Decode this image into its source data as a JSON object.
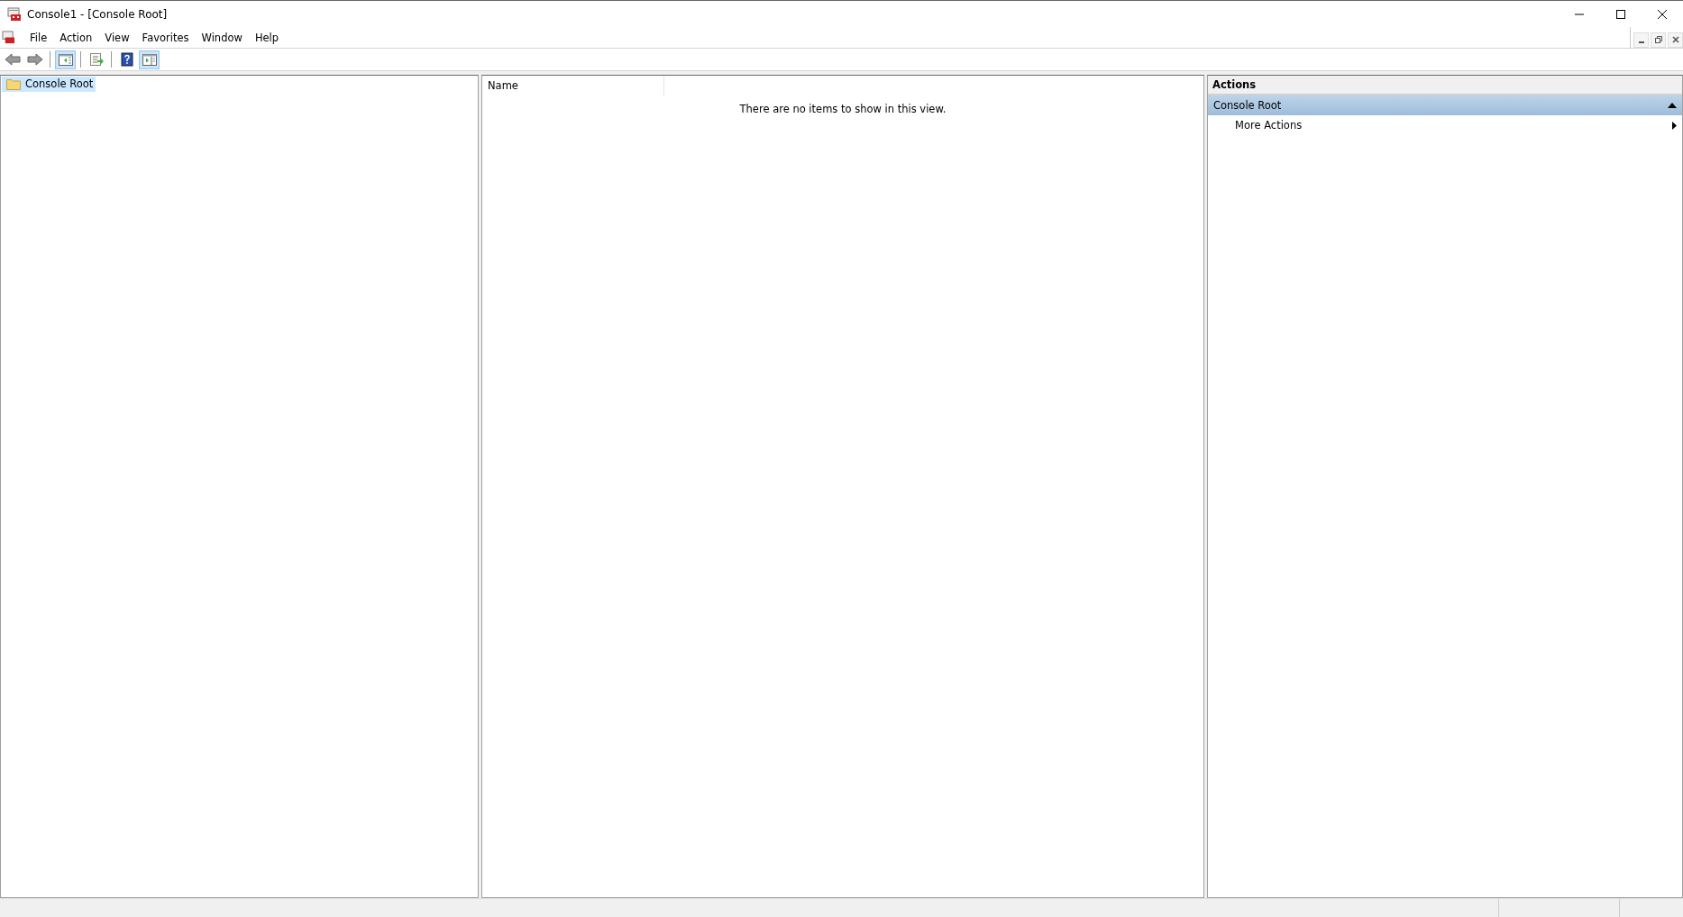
{
  "window": {
    "title": "Console1 - [Console Root]"
  },
  "menu": [
    "File",
    "Action",
    "View",
    "Favorites",
    "Window",
    "Help"
  ],
  "toolbar": [
    [
      {
        "kind": "back"
      },
      {
        "kind": "forward"
      }
    ],
    [
      {
        "kind": "tree",
        "selected": true
      }
    ],
    [
      {
        "kind": "export"
      }
    ],
    [
      {
        "kind": "help"
      },
      {
        "kind": "actionpane",
        "selected": true
      }
    ]
  ],
  "tree": [
    {
      "label": "Console Root",
      "selected": true
    }
  ],
  "list": {
    "columns": [
      "Name"
    ],
    "empty_message": "There are no items to show in this view."
  },
  "actions": {
    "title": "Actions",
    "sections": [
      {
        "title": "Console Root",
        "expanded": true,
        "items": [
          {
            "label": "More Actions",
            "submenu": true
          }
        ]
      }
    ]
  }
}
